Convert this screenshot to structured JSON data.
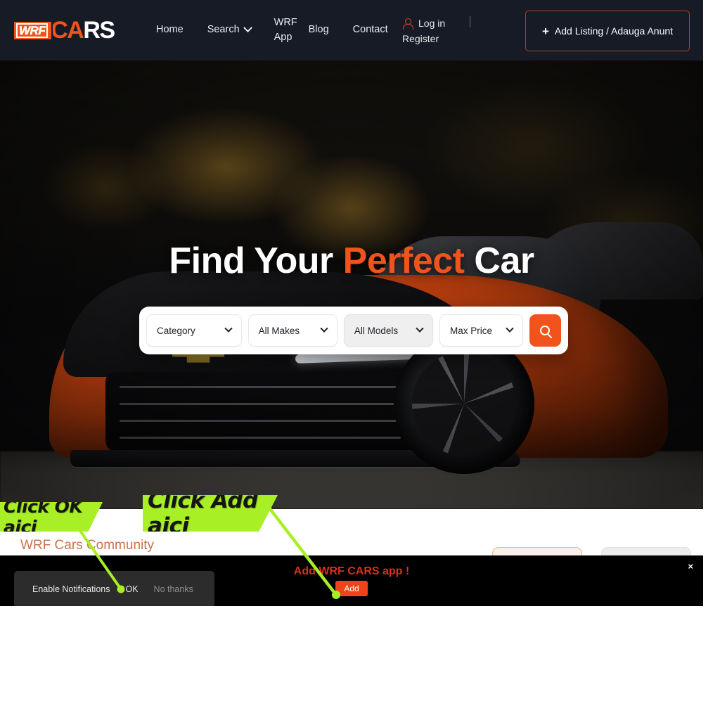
{
  "site": {
    "header": {
      "logo": {
        "badge_text": "WRF",
        "word_orange": "CA",
        "word_white": "RS"
      },
      "nav": [
        {
          "label": "Home",
          "has_dropdown": false
        },
        {
          "label": "Search",
          "has_dropdown": true
        },
        {
          "label": "WRF App",
          "has_dropdown": false
        },
        {
          "label": "Blog",
          "has_dropdown": false
        },
        {
          "label": "Contact",
          "has_dropdown": false
        }
      ],
      "account": {
        "login_label": "Log in",
        "register_label": "Register",
        "icon": "user-icon"
      },
      "cta": {
        "label": "Add Listing / Adauga Anunt",
        "plus": "+",
        "border_color": "#a2462c"
      }
    },
    "hero": {
      "title_part1": "Find Your ",
      "title_highlight": "Perfect",
      "title_part2": " Car",
      "highlight_color": "#f0531c",
      "search": {
        "fields": [
          {
            "label": "Category",
            "state": "normal"
          },
          {
            "label": "All Makes",
            "state": "normal"
          },
          {
            "label": "All Models",
            "state": "hover"
          },
          {
            "label": "Max Price",
            "state": "normal"
          }
        ],
        "button_icon": "search-icon",
        "button_color": "#f0531c"
      }
    },
    "community": {
      "title": "WRF Cars Community",
      "title_color": "#c9734c",
      "buttons": [
        {
          "name": "community-primary-button",
          "style": "peach"
        },
        {
          "name": "community-secondary-button",
          "style": "gray"
        }
      ]
    }
  },
  "appbar": {
    "title": "Add WRF CARS app !",
    "title_color": "#d9311a",
    "add_label": "Add",
    "add_color": "#f0431a",
    "close_label": "×",
    "background": "#000000"
  },
  "notification_prompt": {
    "label": "Enable Notifications",
    "accept_label": "OK",
    "decline_label": "No thanks",
    "background": "#2c2c2c"
  },
  "annotations": {
    "color": "#a8ef25",
    "callouts": [
      {
        "text": "Click OK aici",
        "points_to": "notification-ok-button"
      },
      {
        "text": "Click Add aici",
        "points_to": "appbar-add-button"
      }
    ]
  }
}
